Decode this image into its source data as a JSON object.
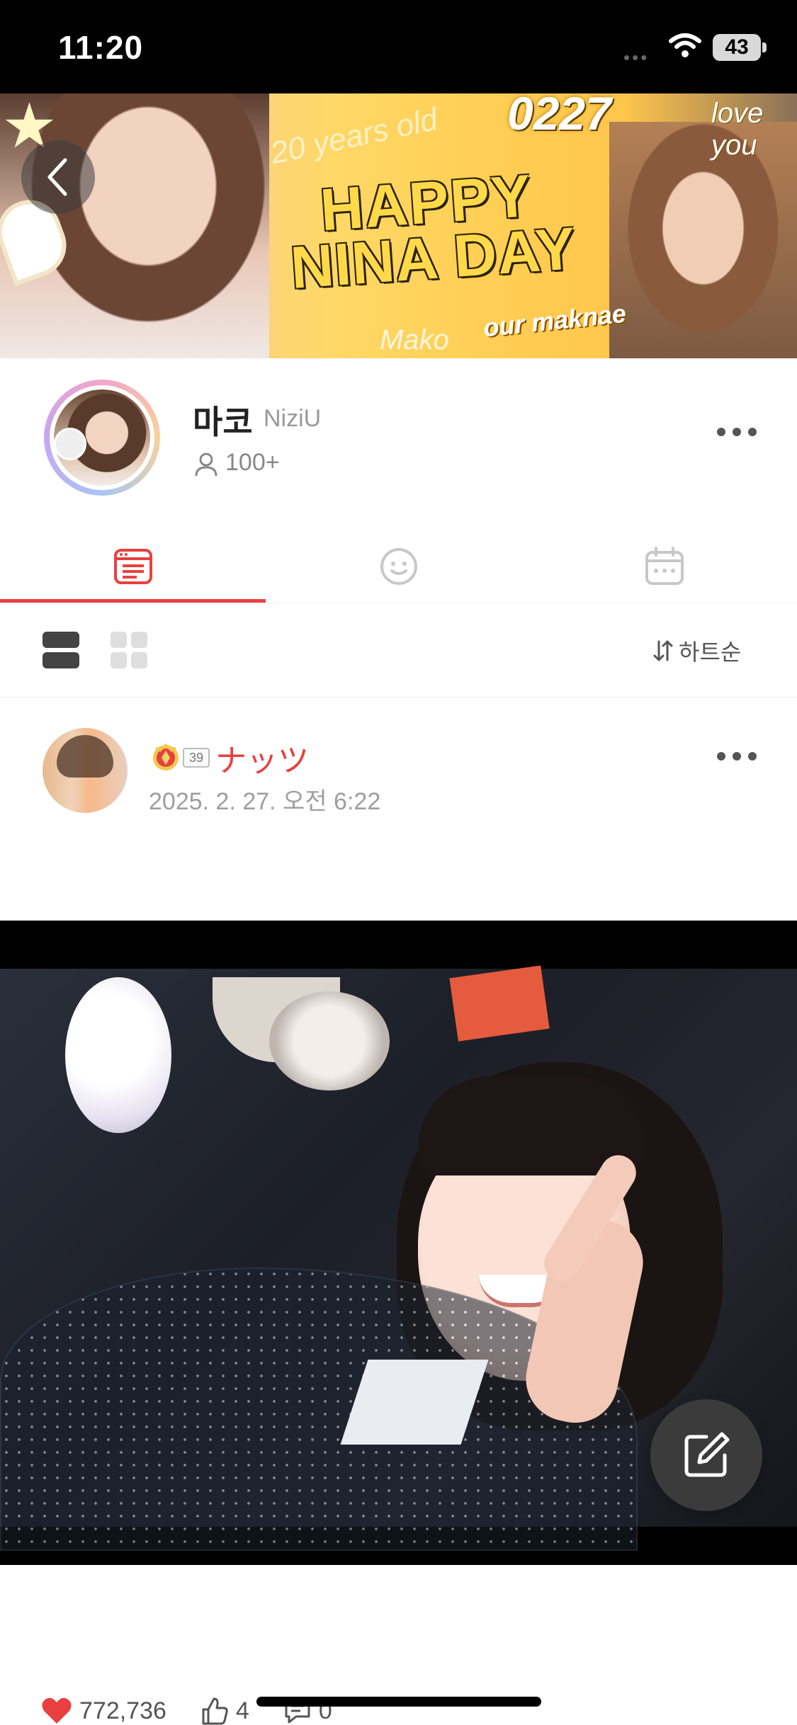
{
  "status_bar": {
    "time": "11:20",
    "battery": "43",
    "signal_dots": "•••"
  },
  "banner": {
    "date": "0227",
    "headline_line1": "HAPPY",
    "headline_line2": "NINA DAY",
    "tag": "our maknae",
    "note_top_left": "20 years old",
    "note_top_right": "love you",
    "signature": "Mako"
  },
  "profile": {
    "name": "마코",
    "group": "NiziU",
    "member_count": "100+"
  },
  "tabs": [
    {
      "icon": "feed-icon",
      "active": true
    },
    {
      "icon": "smiley-icon",
      "active": false
    },
    {
      "icon": "calendar-icon",
      "active": false
    }
  ],
  "toolbar": {
    "sort_label": "하트순"
  },
  "post": {
    "author": "ナッツ",
    "level": "39",
    "date": "2025. 2. 27. 오전 6:22",
    "likes": "772,736",
    "thumbs": "4",
    "comments": "0"
  },
  "colors": {
    "accent": "#e8403f",
    "compose": "#3b3b3b"
  }
}
